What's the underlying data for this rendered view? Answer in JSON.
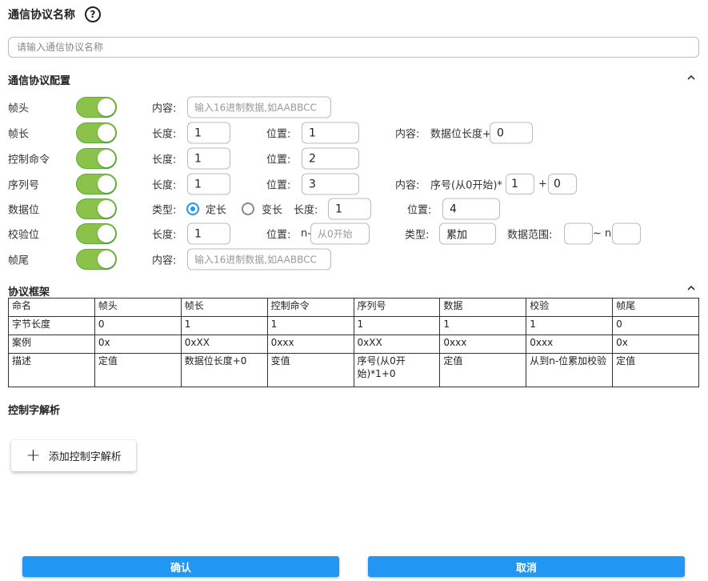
{
  "header": {
    "title": "通信协议名称",
    "help_icon": "?"
  },
  "name_input": {
    "placeholder": "请输入通信协议名称",
    "value": ""
  },
  "config": {
    "title": "通信协议配置",
    "accent_color": "#8bc34a",
    "rows": {
      "frame_head": {
        "label": "帧头",
        "enabled": true,
        "content_label": "内容:",
        "content_placeholder": "输入16进制数据,如AABBCC"
      },
      "frame_length": {
        "label": "帧长",
        "enabled": true,
        "length_label": "长度:",
        "length_value": "1",
        "position_label": "位置:",
        "position_value": "1",
        "content_label": "内容:",
        "content_prefix": "数据位长度+",
        "content_value": "0"
      },
      "control_cmd": {
        "label": "控制命令",
        "enabled": true,
        "length_label": "长度:",
        "length_value": "1",
        "position_label": "位置:",
        "position_value": "2"
      },
      "sequence": {
        "label": "序列号",
        "enabled": true,
        "length_label": "长度:",
        "length_value": "1",
        "position_label": "位置:",
        "position_value": "3",
        "content_label": "内容:",
        "content_prefix": "序号(从0开始)*",
        "multiplier_value": "1",
        "plus": "+",
        "offset_value": "0"
      },
      "data": {
        "label": "数据位",
        "enabled": true,
        "type_label": "类型:",
        "option_fixed": "定长",
        "option_variable": "变长",
        "selected": "定长",
        "length_label": "长度:",
        "length_value": "1",
        "position_label": "位置:",
        "position_value": "4"
      },
      "checksum": {
        "label": "校验位",
        "enabled": true,
        "length_label": "长度:",
        "length_value": "1",
        "position_label": "位置:",
        "position_prefix": "n-",
        "position_placeholder": "从0开始",
        "type_label": "类型:",
        "type_value": "累加",
        "range_label": "数据范围:",
        "range_sep": "~ n-"
      },
      "frame_tail": {
        "label": "帧尾",
        "enabled": true,
        "content_label": "内容:",
        "content_placeholder": "输入16进制数据,如AABBCC"
      }
    }
  },
  "frame_table": {
    "title": "协议框架",
    "rows": [
      [
        "命名",
        "帧头",
        "帧长",
        "控制命令",
        "序列号",
        "数据",
        "校验",
        "帧尾"
      ],
      [
        "字节长度",
        "0",
        "1",
        "1",
        "1",
        "1",
        "1",
        "0"
      ],
      [
        "案例",
        "0x",
        "0xXX",
        "0xxx",
        "0xXX",
        "0xxx",
        "0xxx",
        "0x"
      ],
      [
        "描述",
        "定值",
        "数据位长度+0",
        "变值",
        "序号(从0开始)*1+0",
        "定值",
        "从到n-位累加校验",
        "定值"
      ]
    ]
  },
  "control_parse": {
    "title": "控制字解析",
    "add_button": "添加控制字解析"
  },
  "footer": {
    "confirm": "确认",
    "cancel": "取消",
    "button_color": "#2196f3"
  }
}
